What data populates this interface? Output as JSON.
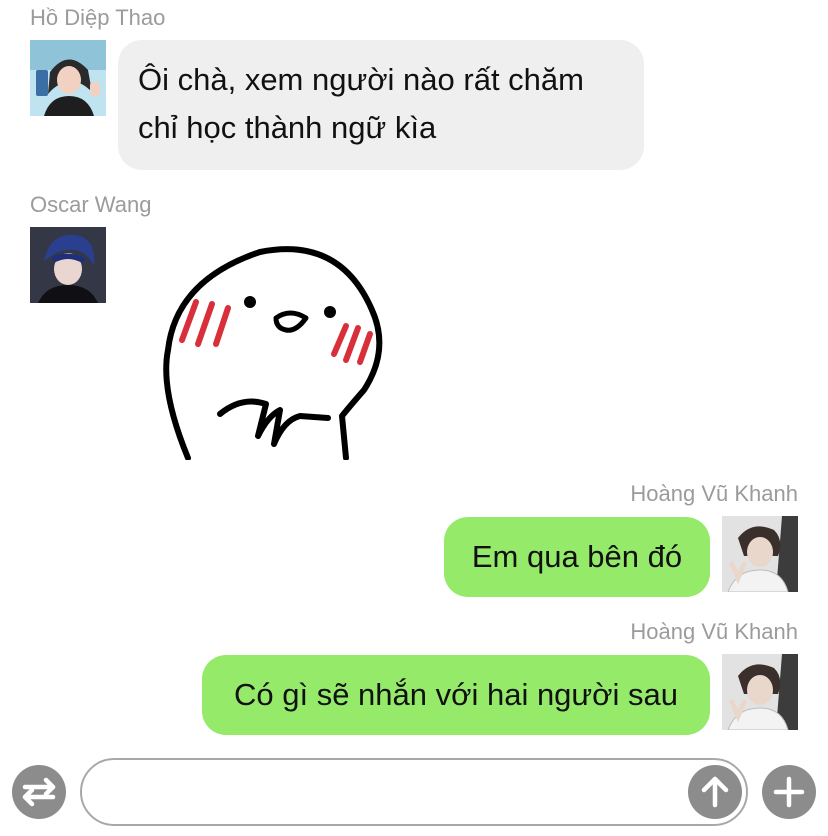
{
  "messages": [
    {
      "sender": "Hồ Diệp Thao",
      "text": "Ôi chà, xem người nào rất chăm chỉ học thành ngữ kìa",
      "direction": "incoming",
      "avatar": "avatar-blonde-phone"
    },
    {
      "sender": "Oscar Wang",
      "text": "",
      "sticker": "blushing-shy-round-face-sticker",
      "direction": "incoming",
      "avatar": "avatar-blue-hair"
    },
    {
      "sender": "Hoàng Vũ Khanh",
      "text": "Em qua bên đó",
      "direction": "outgoing",
      "avatar": "avatar-peace-sign"
    },
    {
      "sender": "Hoàng Vũ Khanh",
      "text": "Có gì sẽ nhắn với hai người sau",
      "direction": "outgoing",
      "avatar": "avatar-peace-sign"
    }
  ],
  "input_bar": {
    "placeholder": "",
    "switch_icon": "swap-arrows-icon",
    "send_icon": "arrow-up-icon",
    "add_icon": "plus-icon"
  },
  "colors": {
    "incoming_bubble": "#efefef",
    "outgoing_bubble": "#95ea6a",
    "sender_name": "#9b9b9b",
    "icon_gray": "#8c8c8c",
    "blush": "#d8303a"
  }
}
